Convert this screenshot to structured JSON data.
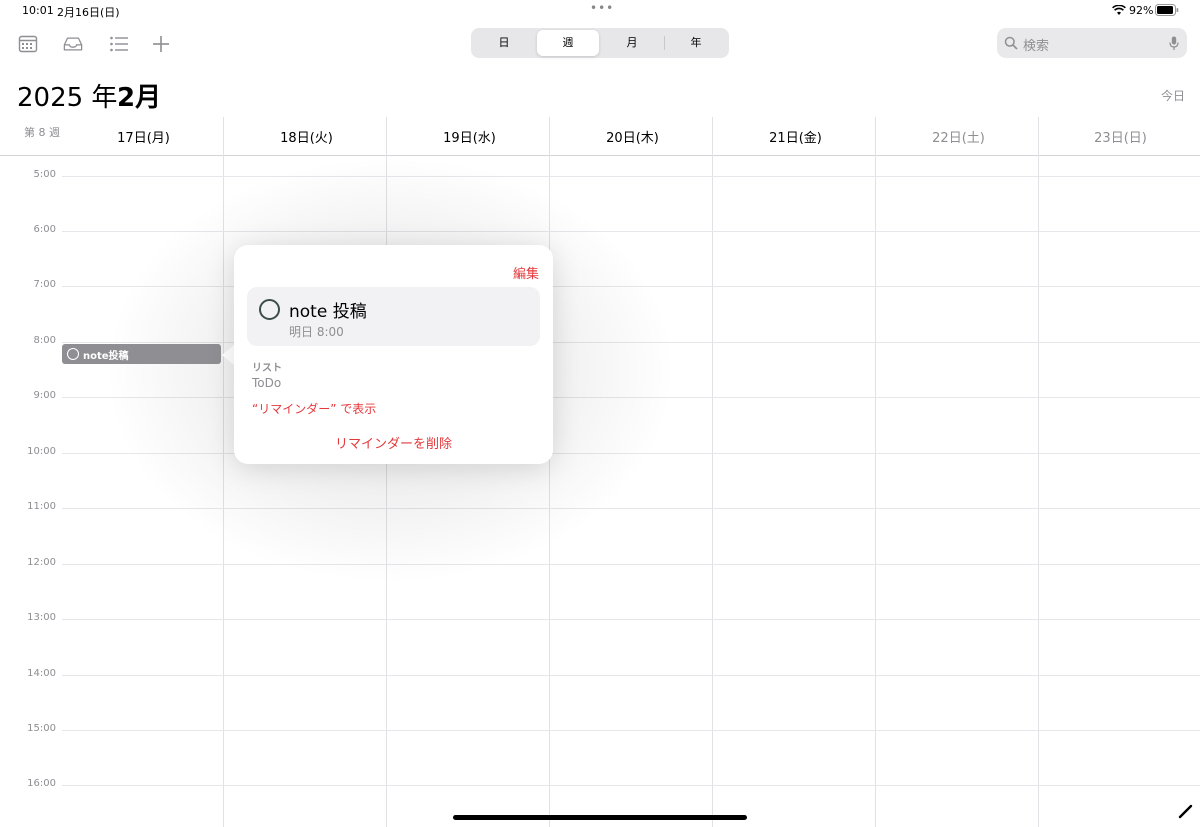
{
  "status_bar": {
    "time": "10:01",
    "date": "2月16日(日)",
    "battery": "92%"
  },
  "toolbar": {
    "icons": [
      "calendar-icon",
      "inbox-icon",
      "list-icon",
      "add-icon"
    ],
    "view_options": [
      "日",
      "週",
      "月",
      "年"
    ],
    "selected_view": "週",
    "search_placeholder": "検索"
  },
  "header": {
    "year": "2025 年",
    "month": "2月",
    "today_button": "今日",
    "week_number": "第 8 週"
  },
  "days": [
    {
      "label": "17日(月)",
      "weekend": false
    },
    {
      "label": "18日(火)",
      "weekend": false
    },
    {
      "label": "19日(水)",
      "weekend": false
    },
    {
      "label": "20日(木)",
      "weekend": false
    },
    {
      "label": "21日(金)",
      "weekend": false
    },
    {
      "label": "22日(土)",
      "weekend": true
    },
    {
      "label": "23日(日)",
      "weekend": true
    }
  ],
  "hours": [
    "5:00",
    "6:00",
    "7:00",
    "8:00",
    "9:00",
    "10:00",
    "11:00",
    "12:00",
    "13:00",
    "14:00",
    "15:00",
    "16:00"
  ],
  "event": {
    "label": "note投稿"
  },
  "popover": {
    "edit_label": "編集",
    "title": "note 投稿",
    "due": "明日 8:00",
    "list_label": "リスト",
    "list_value": "ToDo",
    "show_in_label": "“リマインダー” で表示",
    "delete_label": "リマインダーを削除"
  },
  "colors": {
    "accent": "#e5383b",
    "chip": "#8e8e93",
    "reminder_circle": "#3b4f46"
  }
}
